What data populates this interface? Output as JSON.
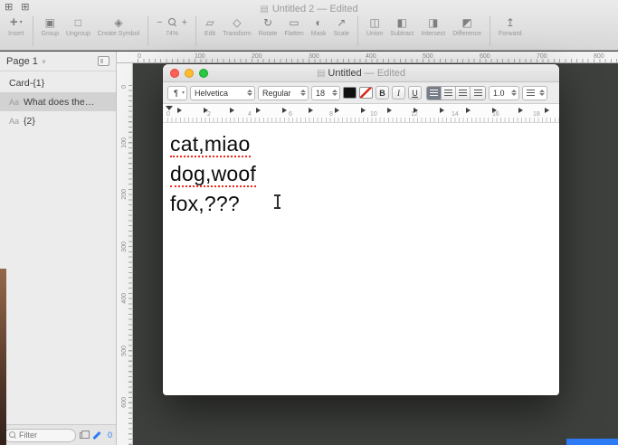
{
  "colors": {
    "accent_blue": "#2e7bf6",
    "misspell_red": "#f2261c",
    "traffic_red": "#ff5f57",
    "traffic_yellow": "#febc2e",
    "traffic_green": "#28c840"
  },
  "sketch": {
    "window_title": "Untitled 2 — Edited",
    "toolbar": {
      "insert": {
        "icon": "+",
        "caret": "▾",
        "label": "Insert"
      },
      "group1": [
        {
          "icon": "▣",
          "label": "Group"
        },
        {
          "icon": "□",
          "label": "Ungroup"
        },
        {
          "icon": "◈",
          "label": "Create Symbol"
        }
      ],
      "zoom": {
        "minus": "−",
        "plus": "+",
        "label": "74%"
      },
      "group2": [
        {
          "icon": "▱",
          "label": "Edit"
        },
        {
          "icon": "◇",
          "label": "Transform"
        },
        {
          "icon": "↻",
          "label": "Rotate"
        },
        {
          "icon": "▭",
          "label": "Flatten"
        }
      ],
      "group3": [
        {
          "icon": "◐",
          "label": "Mask"
        },
        {
          "icon": "↗",
          "label": "Scale"
        }
      ],
      "group4": [
        {
          "icon": "◫",
          "label": "Union"
        },
        {
          "icon": "◧",
          "label": "Subtract"
        },
        {
          "icon": "◨",
          "label": "Intersect"
        },
        {
          "icon": "◩",
          "label": "Difference"
        }
      ],
      "group5": [
        {
          "icon": "↥",
          "label": "Forward"
        }
      ]
    },
    "sidebar": {
      "page_label": "Page 1",
      "page_chevron": "∨",
      "layers": [
        {
          "icon": "",
          "label": "Card-{1}",
          "selected": false
        },
        {
          "icon": "Aa",
          "label": "What does the…",
          "selected": true
        },
        {
          "icon": "Aa",
          "label": "{2}",
          "selected": false
        }
      ],
      "filter_placeholder": "Filter",
      "badge_count": "0"
    },
    "hruler": [
      "0",
      "100",
      "200",
      "300",
      "400",
      "500",
      "600",
      "700",
      "800"
    ],
    "vruler": [
      "0",
      "100",
      "200",
      "300",
      "400",
      "500",
      "600"
    ]
  },
  "textedit": {
    "window_title": "Untitled",
    "window_title_suffix": " — Edited",
    "format": {
      "styles_glyph": "¶",
      "font_family": "Helvetica",
      "font_face": "Regular",
      "font_size": "18",
      "bold": "B",
      "italic": "I",
      "underline": "U",
      "line_spacing": "1.0"
    },
    "ruler_numbers": [
      "0",
      "2",
      "4",
      "6",
      "8",
      "10",
      "12",
      "14",
      "16",
      "18"
    ],
    "tab_stops": [
      "",
      "",
      "",
      "",
      "",
      "",
      "",
      "",
      "",
      "",
      "",
      "",
      "",
      "",
      ""
    ],
    "document_lines": [
      {
        "text": "cat,miao",
        "misspelled": true
      },
      {
        "text": "dog,woof",
        "misspelled": true
      },
      {
        "text": "fox,???",
        "misspelled": false
      }
    ]
  }
}
